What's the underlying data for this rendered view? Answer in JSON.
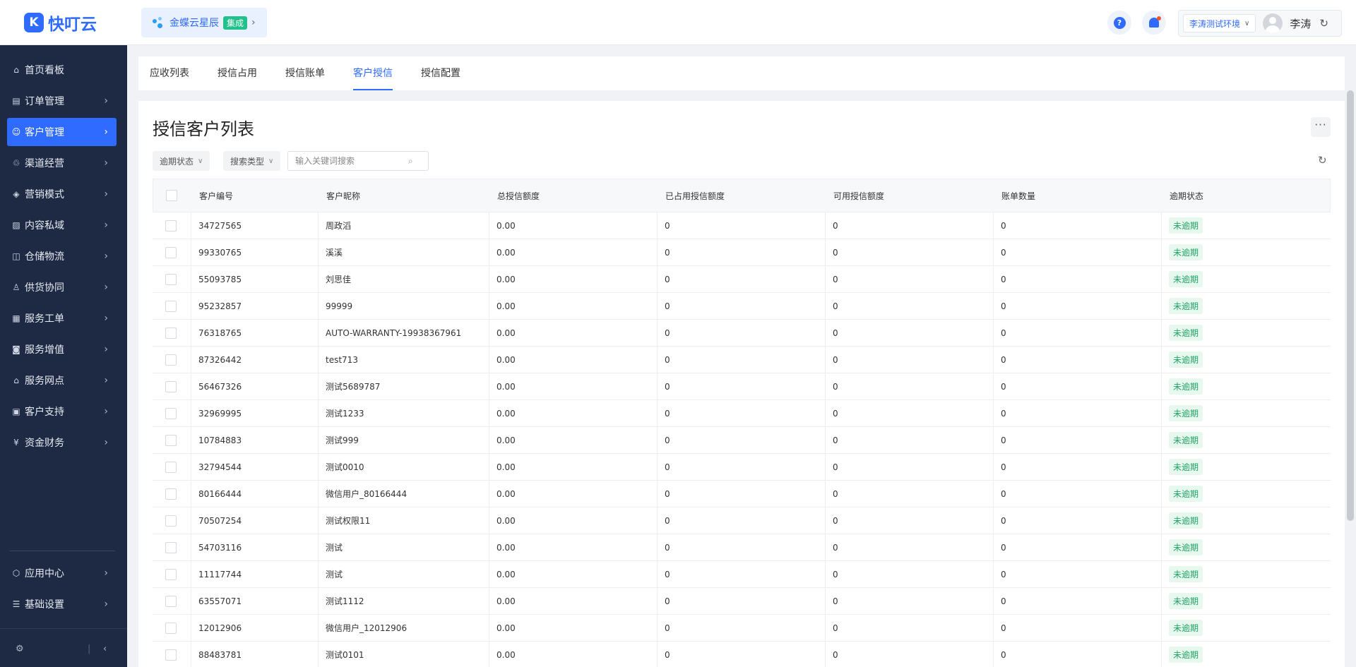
{
  "header": {
    "logo_text": "快叮云",
    "integration": {
      "name": "金蝶云星辰",
      "tag": "集成"
    },
    "environment": "李涛测试环境",
    "user_name": "李涛"
  },
  "sidebar": {
    "items": [
      {
        "label": "首页看板",
        "icon": "home-icon"
      },
      {
        "label": "订单管理",
        "icon": "order-icon"
      },
      {
        "label": "客户管理",
        "icon": "user-icon",
        "active": true
      },
      {
        "label": "渠道经营",
        "icon": "channel-icon"
      },
      {
        "label": "营销模式",
        "icon": "tag-icon"
      },
      {
        "label": "内容私域",
        "icon": "image-icon"
      },
      {
        "label": "仓储物流",
        "icon": "box-icon"
      },
      {
        "label": "供货协同",
        "icon": "supply-icon"
      },
      {
        "label": "服务工单",
        "icon": "ticket-icon"
      },
      {
        "label": "服务增值",
        "icon": "bag-icon"
      },
      {
        "label": "服务网点",
        "icon": "store-icon"
      },
      {
        "label": "客户支持",
        "icon": "support-icon"
      },
      {
        "label": "资金财务",
        "icon": "yuan-icon"
      }
    ],
    "bottom_items": [
      {
        "label": "应用中心",
        "icon": "cube-icon"
      },
      {
        "label": "基础设置",
        "icon": "settings-icon"
      }
    ]
  },
  "tabs": [
    {
      "label": "应收列表"
    },
    {
      "label": "授信占用"
    },
    {
      "label": "授信账单"
    },
    {
      "label": "客户授信",
      "active": true
    },
    {
      "label": "授信配置"
    }
  ],
  "panel": {
    "title": "授信客户列表",
    "filters": {
      "overdue_status": "逾期状态",
      "search_type": "搜索类型"
    },
    "search": {
      "placeholder": "输入关键词搜索"
    }
  },
  "table": {
    "columns": [
      "客户编号",
      "客户昵称",
      "总授信额度",
      "已占用授信额度",
      "可用授信额度",
      "账单数量",
      "逾期状态"
    ],
    "rows": [
      [
        "34727565",
        "周政滔",
        "0.00",
        "0",
        "0",
        "0",
        "未逾期"
      ],
      [
        "99330765",
        "溪溪",
        "0.00",
        "0",
        "0",
        "0",
        "未逾期"
      ],
      [
        "55093785",
        "刘思佳",
        "0.00",
        "0",
        "0",
        "0",
        "未逾期"
      ],
      [
        "95232857",
        "99999",
        "0.00",
        "0",
        "0",
        "0",
        "未逾期"
      ],
      [
        "76318765",
        "AUTO-WARRANTY-19938367961",
        "0.00",
        "0",
        "0",
        "0",
        "未逾期"
      ],
      [
        "87326442",
        "test713",
        "0.00",
        "0",
        "0",
        "0",
        "未逾期"
      ],
      [
        "56467326",
        "测试5689787",
        "0.00",
        "0",
        "0",
        "0",
        "未逾期"
      ],
      [
        "32969995",
        "测试1233",
        "0.00",
        "0",
        "0",
        "0",
        "未逾期"
      ],
      [
        "10784883",
        "测试999",
        "0.00",
        "0",
        "0",
        "0",
        "未逾期"
      ],
      [
        "32794544",
        "测试0010",
        "0.00",
        "0",
        "0",
        "0",
        "未逾期"
      ],
      [
        "80166444",
        "微信用户_80166444",
        "0.00",
        "0",
        "0",
        "0",
        "未逾期"
      ],
      [
        "70507254",
        "测试权限11",
        "0.00",
        "0",
        "0",
        "0",
        "未逾期"
      ],
      [
        "54703116",
        "测试",
        "0.00",
        "0",
        "0",
        "0",
        "未逾期"
      ],
      [
        "11117744",
        "测试",
        "0.00",
        "0",
        "0",
        "0",
        "未逾期"
      ],
      [
        "63557071",
        "测试1112",
        "0.00",
        "0",
        "0",
        "0",
        "未逾期"
      ],
      [
        "12012906",
        "微信用户_12012906",
        "0.00",
        "0",
        "0",
        "0",
        "未逾期"
      ],
      [
        "88483781",
        "测试0101",
        "0.00",
        "0",
        "0",
        "0",
        "未逾期"
      ]
    ]
  }
}
